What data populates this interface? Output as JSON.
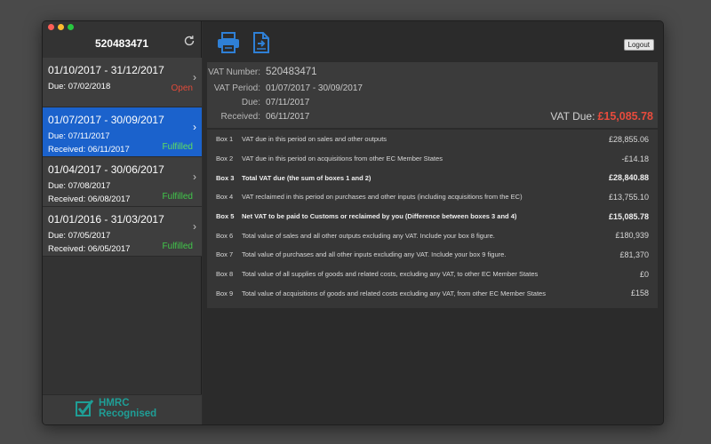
{
  "window": {
    "traffic_lights": {
      "close": "#fe5f57",
      "minimize": "#febc2e",
      "zoom": "#28c840"
    }
  },
  "sidebar": {
    "vrn": "520483471",
    "refresh_icon": "refresh-icon",
    "periods": [
      {
        "range": "01/10/2017 - 31/12/2017",
        "due": "Due: 07/02/2018",
        "received": "",
        "status": "Open",
        "status_color": "#e04a3a"
      },
      {
        "range": "01/07/2017 - 30/09/2017",
        "due": "Due: 07/11/2017",
        "received": "Received: 06/11/2017",
        "status": "Fulfilled",
        "status_color": "#5ee05e"
      },
      {
        "range": "01/04/2017 - 30/06/2017",
        "due": "Due: 07/08/2017",
        "received": "Received: 06/08/2017",
        "status": "Fulfilled",
        "status_color": "#41c84a"
      },
      {
        "range": "01/01/2016 - 31/03/2017",
        "due": "Due: 07/05/2017",
        "received": "Received: 06/05/2017",
        "status": "Fulfilled",
        "status_color": "#41c84a"
      }
    ],
    "hmrc": {
      "line1": "HMRC",
      "line2": "Recognised",
      "color": "#1f9e96"
    }
  },
  "toolbar": {
    "print_icon": "printer-icon",
    "export_icon": "export-document-icon",
    "logout_label": "Logout"
  },
  "summary": {
    "vat_number_label": "VAT Number:",
    "vat_number": "520483471",
    "vat_period_label": "VAT Period:",
    "vat_period": "01/07/2017 - 30/09/2017",
    "due_label": "Due:",
    "due": "07/11/2017",
    "received_label": "Received:",
    "received": "06/11/2017",
    "vat_due_label": "VAT Due:",
    "vat_due_value": "£15,085.78",
    "vat_due_color": "#e84b3c"
  },
  "boxes": [
    {
      "num": "Box 1",
      "desc": "VAT due in this period on sales and other outputs",
      "amount": "£28,855.06",
      "bold": false
    },
    {
      "num": "Box 2",
      "desc": "VAT due in this period on acquisitions from other EC Member States",
      "amount": "-£14.18",
      "bold": false
    },
    {
      "num": "Box 3",
      "desc": "Total VAT due (the sum of boxes 1 and 2)",
      "amount": "£28,840.88",
      "bold": true
    },
    {
      "num": "Box 4",
      "desc": "VAT reclaimed in this period on purchases and other inputs (including acquisitions from the EC)",
      "amount": "£13,755.10",
      "bold": false
    },
    {
      "num": "Box 5",
      "desc": "Net VAT to be paid to Customs or reclaimed by you (Difference between boxes 3 and 4)",
      "amount": "£15,085.78",
      "bold": true
    },
    {
      "num": "Box 6",
      "desc": "Total value of sales and all other outputs excluding any VAT. Include your box 8 figure.",
      "amount": "£180,939",
      "bold": false
    },
    {
      "num": "Box 7",
      "desc": "Total value of purchases and all other inputs excluding any VAT. Include your box 9 figure.",
      "amount": "£81,370",
      "bold": false
    },
    {
      "num": "Box 8",
      "desc": "Total value of all supplies of goods and related costs, excluding any VAT, to other EC Member States",
      "amount": "£0",
      "bold": false
    },
    {
      "num": "Box 9",
      "desc": "Total value of acquisitions of goods and related costs excluding any VAT, from other EC Member States",
      "amount": "£158",
      "bold": false
    }
  ],
  "colors": {
    "accent": "#1b62cc",
    "icon_blue": "#2f80d6"
  }
}
